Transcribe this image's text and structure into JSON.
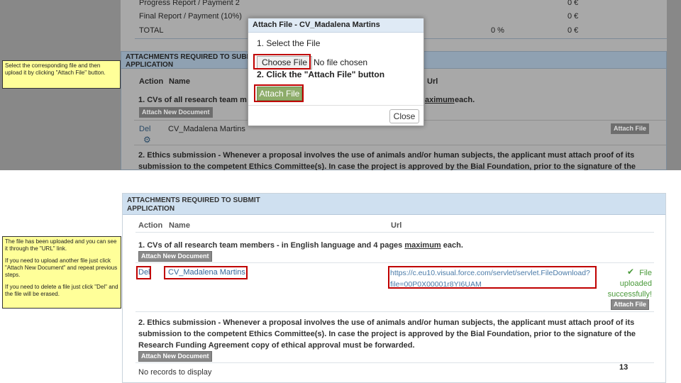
{
  "top": {
    "rows": [
      {
        "label": "Progress Report / Payment 2",
        "amount": "0 €"
      },
      {
        "label": "Final Report / Payment (10%)",
        "amount": "0 €"
      },
      {
        "label": "TOTAL",
        "percent": "0 %",
        "amount": "0 €"
      }
    ],
    "panel_title_line1": "ATTACHMENTS REQUIRED TO SUBMIT",
    "panel_title_line2": "APPLICATION",
    "col_action": "Action",
    "col_name": "Name",
    "col_url": "Url",
    "req1_start": "1. CVs of all research team m",
    "req1_end": "each.",
    "req1_max": "aximum",
    "attach_new_doc": "Attach New Document",
    "del": "Del",
    "file_name": "CV_Madalena Martins",
    "attach_file": "Attach File",
    "ethics_line1": "2. Ethics submission - Whenever a proposal involves the use of animals and/or human subjects, the applicant must attach proof of its",
    "ethics_line2": "submission to the competent Ethics Committee(s). In case the project is approved by the Bial Foundation, prior to the signature of the"
  },
  "dialog": {
    "title": "Attach File - CV_Madalena Martins",
    "step1": "1. Select the File",
    "choose_file": "Choose File",
    "no_file": "No file chosen",
    "step2": "2. Click the \"Attach File\" button",
    "attach_file": "Attach File",
    "close": "Close"
  },
  "note_top": "Select the corresponding file and then upload it by clicking \"Attach File\" button.",
  "bottom": {
    "panel_title_line1": "ATTACHMENTS REQUIRED TO SUBMIT",
    "panel_title_line2": "APPLICATION",
    "col_action": "Action",
    "col_name": "Name",
    "col_url": "Url",
    "req1_text": "1. CVs of all research team members - in English language and 4 pages",
    "req1_max": "maximum",
    "req1_end": "each.",
    "attach_new_doc": "Attach New Document",
    "del": "Del",
    "file_name": "CV_Madalena Martins",
    "url_line1": "https://c.eu10.visual.force.com/servlet/servlet.FileDownload?",
    "url_line2": "file=00P0X00001r8YI6UAM",
    "uploaded_1": "File",
    "uploaded_2": "uploaded",
    "uploaded_3": "successfully!",
    "attach_file": "Attach File",
    "ethics_line1": "2. Ethics submission - Whenever a proposal involves the use of animals and/or human subjects, the applicant must attach proof of its",
    "ethics_line2": "submission to the competent Ethics Committee(s). In case the project is approved by the Bial Foundation, prior to the signature of the",
    "ethics_line3": "Research Funding Agreement copy of ethical approval must be forwarded.",
    "attach_new_doc_2": "Attach New Document",
    "no_records": "No records to display"
  },
  "note_bottom": {
    "p1": "The file has been uploaded and you can see it through the \"URL\" link.",
    "p2": "If you need to upload another file just click \"Attach New Document\" and repeat previous steps.",
    "p3": "If you need to delete a file just click \"Del\" and the file will be erased."
  },
  "page_number": "13"
}
